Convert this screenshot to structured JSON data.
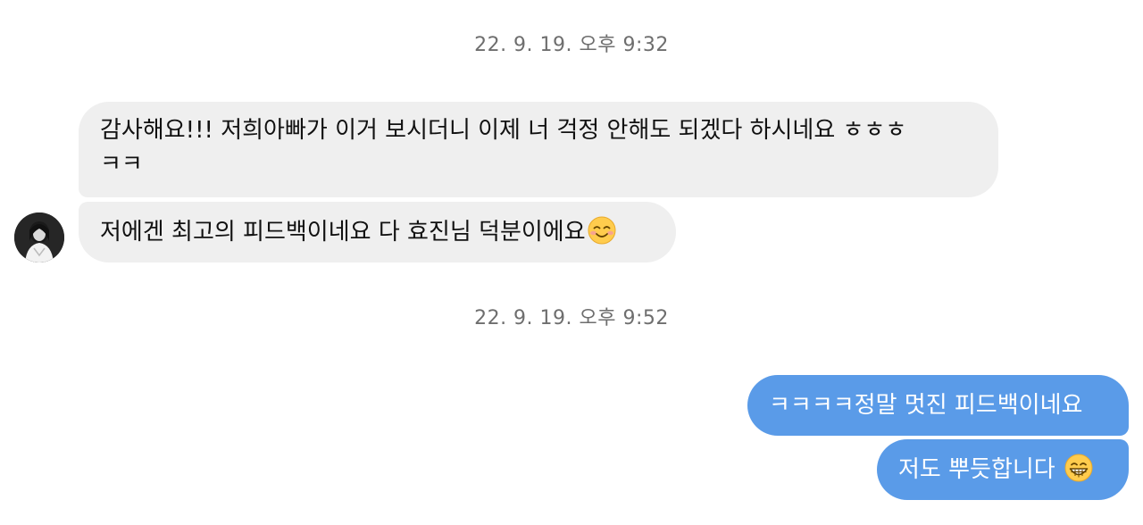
{
  "timestamps": [
    "22. 9. 19. 오후 9:32",
    "22. 9. 19. 오후 9:52"
  ],
  "messages": {
    "m1": {
      "direction": "incoming",
      "line1": "감사해요!!! 저희아빠가 이거 보시더니 이제 너 걱정 안해도 되겠다 하시네요 ㅎㅎㅎ",
      "line2": "ㅋㅋ"
    },
    "m2": {
      "direction": "incoming",
      "text": "저에겐 최고의 피드백이네요 다 효진님 덕분이에요",
      "emoji": "smiling-face-icon"
    },
    "m3": {
      "direction": "outgoing",
      "text": "ㅋㅋㅋㅋ정말 멋진 피드백이네요"
    },
    "m4": {
      "direction": "outgoing",
      "text": "저도 뿌듯합니다",
      "emoji": "grinning-face-icon"
    }
  },
  "colors": {
    "incoming_bubble": "#efefef",
    "outgoing_bubble": "#5a9be8",
    "timestamp_text": "#6e6e6e"
  }
}
